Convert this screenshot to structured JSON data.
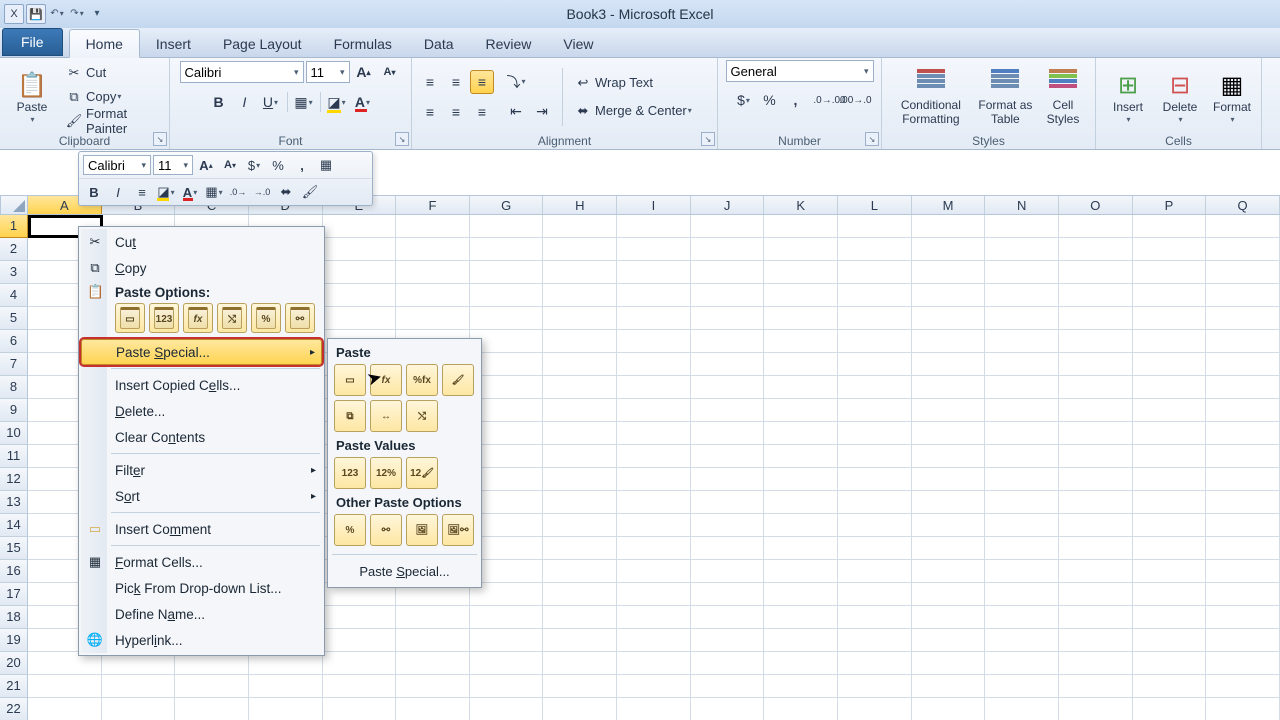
{
  "title": "Book3 - Microsoft Excel",
  "tabs": {
    "file": "File",
    "items": [
      "Home",
      "Insert",
      "Page Layout",
      "Formulas",
      "Data",
      "Review",
      "View"
    ],
    "active": 0
  },
  "clipboard": {
    "label": "Clipboard",
    "paste": "Paste",
    "cut": "Cut",
    "copy": "Copy",
    "painter": "Format Painter"
  },
  "font": {
    "label": "Font",
    "name": "Calibri",
    "size": "11"
  },
  "alignment": {
    "label": "Alignment",
    "wrap": "Wrap Text",
    "merge": "Merge & Center"
  },
  "number": {
    "label": "Number",
    "format": "General"
  },
  "styles": {
    "label": "Styles",
    "cond": "Conditional Formatting",
    "table": "Format as Table",
    "cell": "Cell Styles"
  },
  "cells": {
    "label": "Cells",
    "insert": "Insert",
    "delete": "Delete",
    "format": "Format"
  },
  "mini": {
    "font": "Calibri",
    "size": "11"
  },
  "cols": [
    "A",
    "B",
    "C",
    "D",
    "E",
    "F",
    "G",
    "H",
    "I",
    "J",
    "K",
    "L",
    "M",
    "N",
    "O",
    "P",
    "Q"
  ],
  "rows": [
    1,
    2,
    3,
    4,
    5,
    6,
    7,
    8,
    9,
    10,
    11,
    12,
    13,
    14,
    15,
    16,
    17,
    18,
    19,
    20,
    21,
    22
  ],
  "ctx": {
    "cut": "Cut",
    "copy": "Copy",
    "paste_options": "Paste Options:",
    "paste_special": "Paste Special...",
    "insert_cells": "Insert Copied Cells...",
    "delete": "Delete...",
    "clear": "Clear Contents",
    "filter": "Filter",
    "sort": "Sort",
    "comment": "Insert Comment",
    "format_cells": "Format Cells...",
    "pick": "Pick From Drop-down List...",
    "define_name": "Define Name...",
    "hyperlink": "Hyperlink..."
  },
  "sub": {
    "paste": "Paste",
    "values": "Paste Values",
    "other": "Other Paste Options",
    "special": "Paste Special..."
  }
}
